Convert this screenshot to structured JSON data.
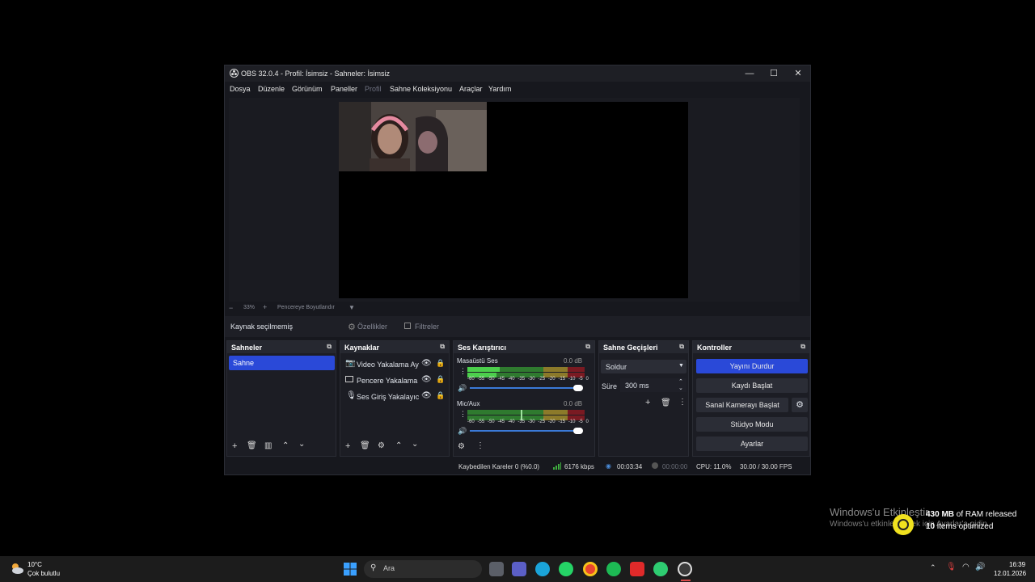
{
  "window": {
    "title": "OBS 32.0.4 - Profil: İsimsiz - Sahneler: İsimsiz",
    "controls": {
      "minimize": "—",
      "maximize": "☐",
      "close": "✕"
    }
  },
  "menu": [
    "Dosya",
    "Düzenle",
    "Görünüm",
    "Paneller",
    "Profil",
    "Sahne Koleksiyonu",
    "Araçlar",
    "Yardım"
  ],
  "preview": {
    "zoom_minus": "−",
    "zoom_value": "33%",
    "zoom_plus": "+",
    "fit_label": "Pencereye Boyutlandır"
  },
  "source_bar": {
    "no_source": "Kaynak seçilmemiş",
    "properties": "Özellikler",
    "filters": "Filtreler"
  },
  "scenes": {
    "title": "Sahneler",
    "items": [
      "Sahne"
    ]
  },
  "sources": {
    "title": "Kaynaklar",
    "items": [
      "Video Yakalama Ay",
      "Pencere Yakalama",
      "Ses Giriş Yakalayıcı"
    ]
  },
  "mixer": {
    "title": "Ses Karıştırıcı",
    "channels": [
      {
        "name": "Masaüstü Ses",
        "db": "0.0 dB",
        "level": 0.28
      },
      {
        "name": "Mic/Aux",
        "db": "0.0 dB",
        "level": 0.0
      }
    ],
    "scale": [
      "-60",
      "-55",
      "-50",
      "-45",
      "-40",
      "-35",
      "-30",
      "-25",
      "-20",
      "-15",
      "-10",
      "-5",
      "0"
    ]
  },
  "transitions": {
    "title": "Sahne Geçişleri",
    "selected": "Soldur",
    "duration_label": "Süre",
    "duration_value": "300 ms"
  },
  "controls": {
    "title": "Kontroller",
    "stop_stream": "Yayını Durdur",
    "start_record": "Kaydı Başlat",
    "virtual_cam": "Sanal Kamerayı Başlat",
    "studio_mode": "Stüdyo Modu",
    "settings": "Ayarlar"
  },
  "status": {
    "dropped": "Kaybedilen Kareler 0 (%0.0)",
    "bitrate": "6176 kbps",
    "stream_time": "00:03:34",
    "rec_time": "00:00:00",
    "cpu": "CPU: 11.0%",
    "fps": "30.00 / 30.00 FPS"
  },
  "watermark": {
    "line1": "Windows'u Etkinleştir",
    "line2": "Windows'u etkinleştirmek için Ayarlar'a gidin."
  },
  "ram_toast": {
    "ram_value": "430 MB",
    "ram_text": "of RAM released",
    "items_value": "10",
    "items_text": "items optimized"
  },
  "weather": {
    "temp": "10°C",
    "desc": "Çok bulutlu"
  },
  "taskbar": {
    "search": "Ara",
    "time": "16:39",
    "date": "12.01.2026"
  },
  "colors": {
    "accent": "#2a49d8",
    "meter_green": "#3fae3f",
    "meter_yellow": "#a8a83a",
    "meter_red": "#8c1a22"
  }
}
